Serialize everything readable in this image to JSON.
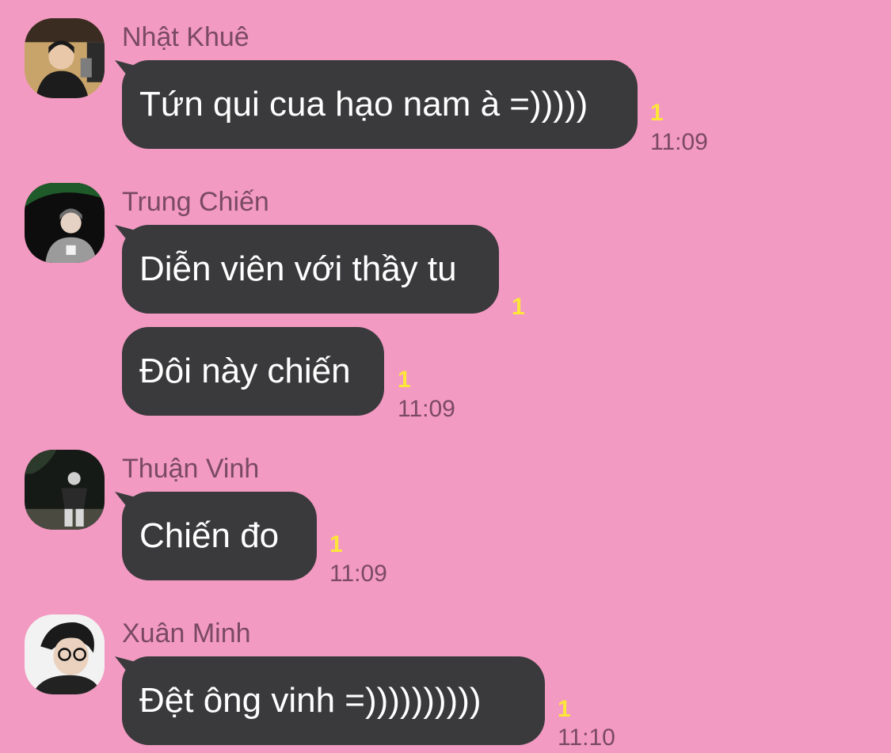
{
  "colors": {
    "background": "#f39ac2",
    "bubble": "#3a3a3c",
    "bubble_text": "#ffffff",
    "sender_name": "#7a4a62",
    "time": "#7a4a62",
    "unread": "#fde63a"
  },
  "groups": [
    {
      "sender": "Nhật Khuê",
      "avatar_icon": "avatar-photo-icon",
      "messages": [
        {
          "text": "Tứn qui cua hạo nam à =)))))",
          "unread": "1",
          "time": "11:09"
        }
      ]
    },
    {
      "sender": "Trung Chiến",
      "avatar_icon": "avatar-photo-icon",
      "messages": [
        {
          "text": "Diễn viên với thầy tu",
          "unread": "1",
          "time": ""
        },
        {
          "text": "Đôi này chiến",
          "unread": "1",
          "time": "11:09"
        }
      ]
    },
    {
      "sender": "Thuận Vinh",
      "avatar_icon": "avatar-photo-icon",
      "messages": [
        {
          "text": "Chiến đo",
          "unread": "1",
          "time": "11:09"
        }
      ]
    },
    {
      "sender": "Xuân Minh",
      "avatar_icon": "avatar-photo-icon",
      "messages": [
        {
          "text": "Đệt ông vinh =))))))))))",
          "unread": "1",
          "time": "11:10"
        }
      ]
    }
  ]
}
